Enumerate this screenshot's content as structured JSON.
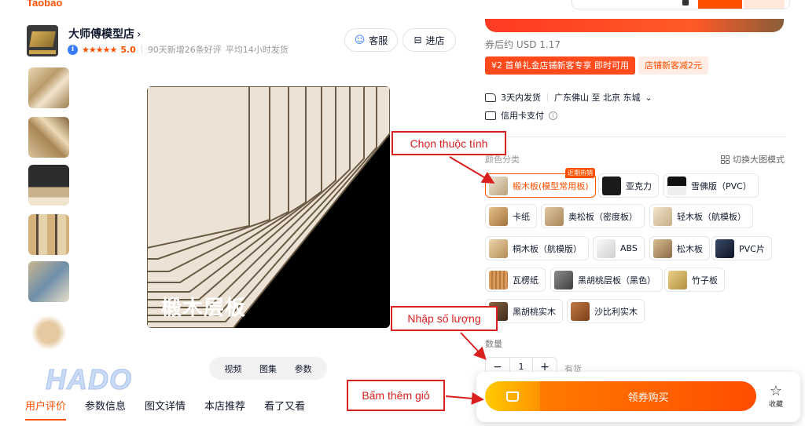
{
  "brand": "Taobao",
  "shop": {
    "name": "大师傅模型店",
    "chevron": "›",
    "verified_mark": "i",
    "stars": "★★★★★",
    "score": "5.0",
    "new_reviews": "90天新增26条好评",
    "avg_delivery": "平均14小时发货",
    "service_label": "客服",
    "store_label": "进店"
  },
  "main_image": {
    "caption": "椴木层板",
    "media_tabs": [
      "视频",
      "图集",
      "参数"
    ]
  },
  "watermark": "HADO",
  "bottom_tabs": [
    "用户评价",
    "参数信息",
    "图文详情",
    "本店推荐",
    "看了又看"
  ],
  "price": {
    "after_coupon": "券后约 USD 1.17",
    "coupon_gift": "¥2 首单礼金店铺新客专享 即时可用",
    "coupon_new": "店铺新客减2元"
  },
  "shipping": {
    "delivery": "3天内发货",
    "route": "广东佛山 至 北京 东城",
    "route_chevron": "⌄",
    "payment": "信用卡支付",
    "info_mark": "i"
  },
  "options": {
    "label": "颜色分类",
    "switch_mode": "切换大图模式",
    "hot_tag": "近期热销",
    "items": [
      {
        "label": "椴木板(模型常用板)",
        "swatch": "#d8c7a6",
        "selected": true
      },
      {
        "label": "亚克力",
        "swatch": "#1a1a1a",
        "selected": false
      },
      {
        "label": "雪佛版（PVC）",
        "swatch": "#2b2b2b",
        "selected": false
      },
      {
        "label": "卡纸",
        "swatch": "#c79a5e",
        "selected": false
      },
      {
        "label": "奥松板（密度板）",
        "swatch": "#c9a878",
        "selected": false
      },
      {
        "label": "轻木板（航模板）",
        "swatch": "#e2cfae",
        "selected": false
      },
      {
        "label": "桐木板（航模版）",
        "swatch": "#d6b98a",
        "selected": false
      },
      {
        "label": "ABS",
        "swatch": "#f3f3f3",
        "selected": false
      },
      {
        "label": "松木板",
        "swatch": "#bfa07a",
        "selected": false
      },
      {
        "label": "PVC片",
        "swatch": "#23304a",
        "selected": false
      },
      {
        "label": "瓦楞纸",
        "swatch": "#d79a60",
        "selected": false
      },
      {
        "label": "黑胡桃层板（黑色）",
        "swatch": "#6f6f6f",
        "selected": false
      },
      {
        "label": "竹子板",
        "swatch": "#d9b86a",
        "selected": false
      },
      {
        "label": "黑胡桃实木",
        "swatch": "#6b4a33",
        "selected": false
      },
      {
        "label": "沙比利实木",
        "swatch": "#a4612f",
        "selected": false
      }
    ]
  },
  "quantity": {
    "label": "数量",
    "minus": "−",
    "value": "1",
    "plus": "+",
    "stock": "有货"
  },
  "actions": {
    "buy_label": "领券购买",
    "favorite_icon": "☆",
    "favorite_label": "收藏"
  },
  "annotations": {
    "select_attribute": "Chọn thuộc tính",
    "enter_quantity": "Nhập số lượng",
    "add_to_cart": "Bấm thêm giỏ"
  },
  "colors": {
    "accent": "#ff5000",
    "annotation_red": "#d9201f",
    "cart_yellow": "#ffb300"
  }
}
